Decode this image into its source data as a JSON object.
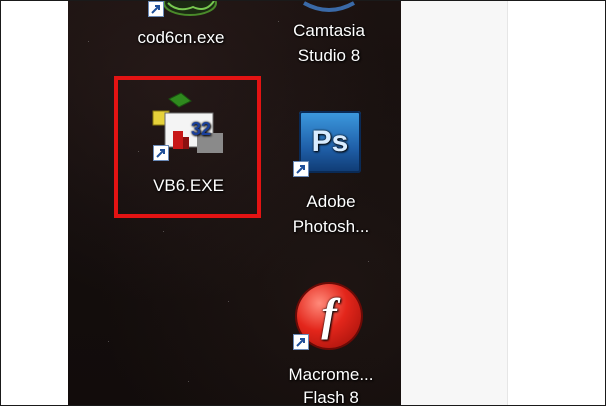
{
  "desktop": {
    "icons": [
      {
        "label": "cod6cn.exe"
      },
      {
        "label_line1": "Camtasia",
        "label_line2": "Studio 8"
      },
      {
        "label": "VB6.EXE"
      },
      {
        "label_line1": "Adobe",
        "label_line2": "Photosh..."
      },
      {
        "label_line1": "Macrome...",
        "label_line2": "Flash 8"
      }
    ]
  },
  "vb6_icon_text": "32",
  "photoshop_icon_text": "Ps",
  "flash_icon_text": "f",
  "colors": {
    "selection_border": "#e31313",
    "desktop_bg": "#161010"
  },
  "icon_names": [
    "cod6cn-game-icon",
    "camtasia-icon",
    "vb6-icon",
    "photoshop-icon",
    "flash-icon",
    "shortcut-arrow-icon"
  ]
}
